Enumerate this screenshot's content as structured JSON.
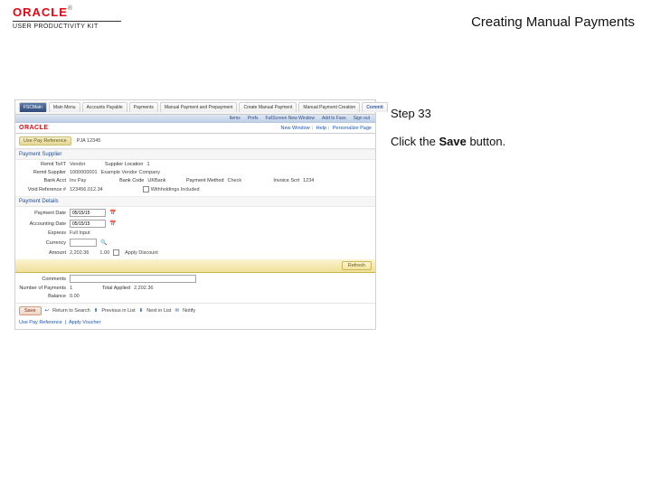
{
  "header": {
    "brand_name": "ORACLE",
    "trademark": "®",
    "brand_sub": "USER PRODUCTIVITY KIT",
    "doc_title": "Creating Manual Payments"
  },
  "right": {
    "step_label": "Step 33",
    "instruction_prefix": "Click the ",
    "instruction_target": "Save",
    "instruction_suffix": " button."
  },
  "topTabs": {
    "first": "FSCMain",
    "items": [
      "Main Menu",
      "Accounts Payable",
      "Payments",
      "Manual Payment and Prepayment",
      "Create Manual Payment",
      "Manual Payment Creation"
    ],
    "last": "Commit"
  },
  "subMeter": {
    "i1": "Items",
    "i2": "Prefs",
    "i3": "FullScreen New Window",
    "i4": "Add to Favs",
    "i5": "Sign out"
  },
  "brandbar": {
    "logo": "ORACLE",
    "l1": "New Window",
    "l2": "Help",
    "l3": "Personalize Page"
  },
  "context": {
    "chip": "Use Pay Reference",
    "val": "PJA 12345"
  },
  "payment": {
    "title": "Payment Supplier",
    "remit_l": "Remit To/IT",
    "remit_v": "Vendor",
    "remit_supplier_l": "Remit Supplier",
    "remit_supplier_v": "1000000001",
    "remit_supplier_extra": "Example Vendor Company",
    "bank_act_l": "Bank Acct",
    "bank_act_v": "Inv Pay",
    "bank_code_l": "Bank Code",
    "bank_code_v": "UKBank",
    "invoice_srt_l": "Invoice Scrt",
    "invoice_srt_v": "1234",
    "supplier_loc_l": "Supplier Location",
    "supplier_loc_v": "1",
    "pay_method_l": "Payment Method",
    "pay_method_v": "Check",
    "void_l": "Void Reference #",
    "void_v": "123456.012.34",
    "withhold_l": "Withholdings Included"
  },
  "pdet": {
    "title": "Payment Details",
    "paydate_l": "Payment Date",
    "paydate_v": "05/15/15",
    "acctdate_l": "Accounting Date",
    "acctdate_v": "05/15/15",
    "express_l": "Express",
    "express_v": "Full Input",
    "currency_l": "Currency",
    "amount_l": "Amount",
    "amount_v": "2,202.36",
    "rate_v": "1.00",
    "apply_sched_l": "Apply Discount",
    "comments_l": "Comments",
    "num_pay_l": "Number of Payments",
    "num_pay_v": "1",
    "tot_app_l": "Total Applied",
    "tot_app_v": "2,202.36",
    "balance_l": "Balance",
    "balance_v": "0.00",
    "refresh_btn": "Refresh"
  },
  "foot": {
    "save_btn": "Save",
    "return_l": "Return to Search",
    "prev_l": "Previous in List",
    "next_l": "Next in List",
    "notify_l": "Notify",
    "note_link": "Use Pay Reference",
    "note_rest": "Apply Voucher"
  }
}
